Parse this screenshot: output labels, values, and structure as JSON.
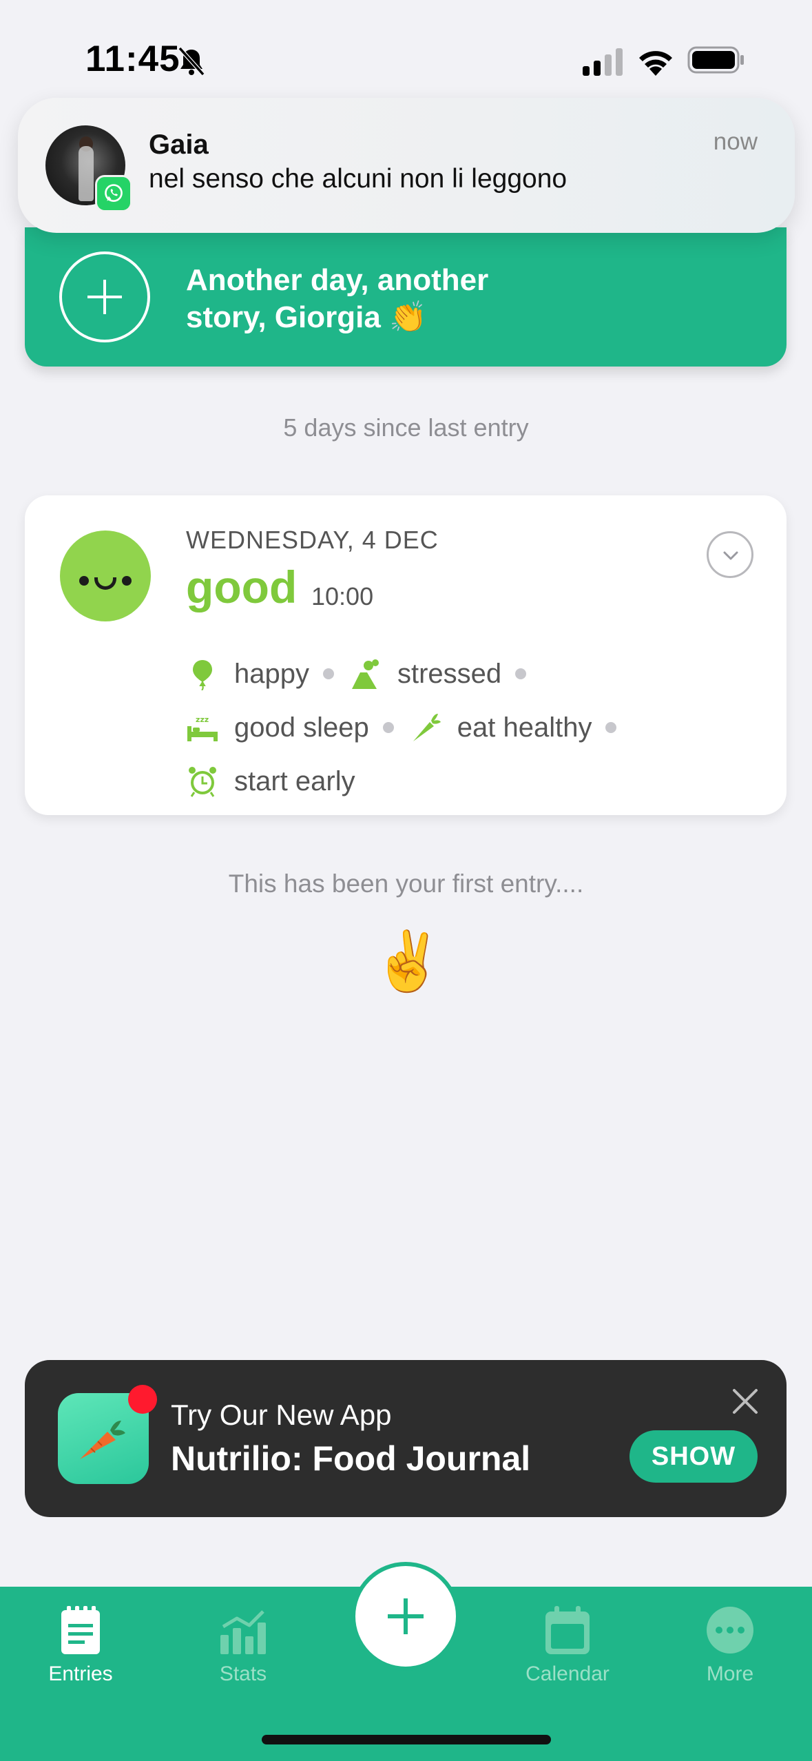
{
  "status_bar": {
    "time": "11:45",
    "icons": [
      "bell-off-icon",
      "signal-icon",
      "wifi-icon",
      "battery-icon"
    ]
  },
  "notification": {
    "app_icon": "whatsapp-icon",
    "sender": "Gaia",
    "message": "nel senso che alcuni non li leggono",
    "time": "now"
  },
  "new_entry_banner": {
    "text": "Another day, another story, Giorgia 👏"
  },
  "since_last_entry": "5 days since last entry",
  "entry": {
    "date": "WEDNESDAY, 4 DEC",
    "mood": "good",
    "time": "10:00",
    "activities": [
      {
        "label": "happy",
        "icon": "balloon-icon"
      },
      {
        "label": "stressed",
        "icon": "volcano-icon"
      },
      {
        "label": "good sleep",
        "icon": "bed-icon"
      },
      {
        "label": "eat healthy",
        "icon": "carrot-icon"
      },
      {
        "label": "start early",
        "icon": "alarm-clock-icon"
      }
    ]
  },
  "first_entry_text": "This has been your first entry....",
  "peace_emoji": "✌️",
  "ad": {
    "line1": "Try Our New App",
    "line2": "Nutrilio: Food Journal",
    "button": "SHOW"
  },
  "tabbar": {
    "tabs": [
      {
        "label": "Entries",
        "icon": "notepad-icon",
        "active": true
      },
      {
        "label": "Stats",
        "icon": "stats-chart-icon",
        "active": false
      },
      {
        "label": "Calendar",
        "icon": "calendar-icon",
        "active": false
      },
      {
        "label": "More",
        "icon": "more-dots-icon",
        "active": false
      }
    ]
  },
  "colors": {
    "accent": "#1fb689",
    "mood_good": "#7fc93c",
    "background": "#f2f2f6"
  }
}
